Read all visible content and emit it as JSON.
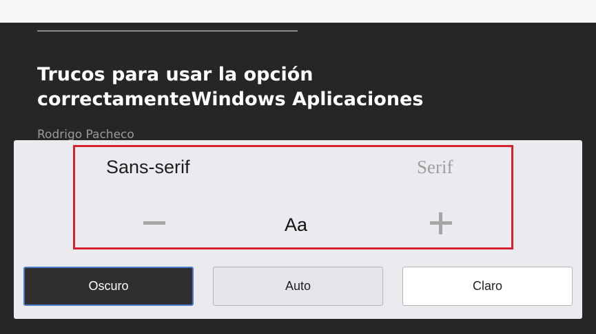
{
  "article": {
    "title_line1": "Trucos para usar la opción",
    "title_line2": "correctamenteWindows Aplicaciones",
    "author": "Rodrigo Pacheco"
  },
  "reader_settings": {
    "font_options": [
      {
        "label": "Sans-serif",
        "selected": true
      },
      {
        "label": "Serif",
        "selected": false
      }
    ],
    "size_label": "Aa",
    "decrease_icon": "minus-icon",
    "increase_icon": "plus-icon",
    "themes": [
      {
        "label": "Oscuro",
        "selected": true
      },
      {
        "label": "Auto",
        "selected": false
      },
      {
        "label": "Claro",
        "selected": false
      }
    ],
    "highlight_color": "#d4202f",
    "selected_theme_border": "#4a7cc7"
  }
}
